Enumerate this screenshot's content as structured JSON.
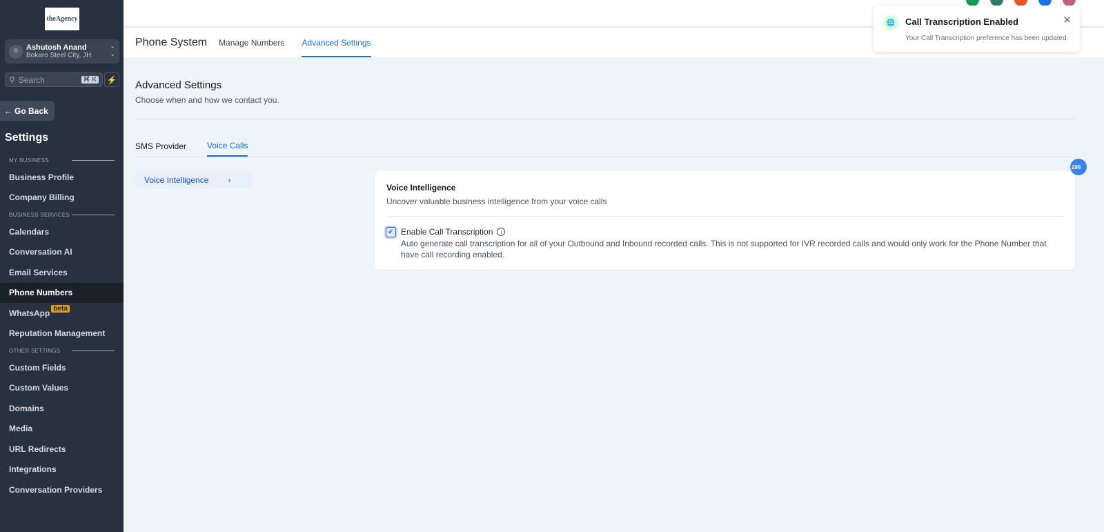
{
  "sidebar": {
    "logo": "theAgency",
    "account": {
      "name": "Ashutosh Anand",
      "location": "Bokaro Steel City, JH"
    },
    "search": {
      "placeholder": "Search",
      "shortcut": "⌘ K"
    },
    "go_back": "Go Back",
    "title": "Settings",
    "sections": [
      {
        "label": "MY BUSINESS",
        "items": [
          "Business Profile",
          "Company Billing"
        ]
      },
      {
        "label": "BUSINESS SERVICES",
        "items": [
          "Calendars",
          "Conversation AI",
          "Email Services",
          "Phone Numbers",
          "WhatsApp",
          "Reputation Management"
        ]
      },
      {
        "label": "OTHER SETTINGS",
        "items": [
          "Custom Fields",
          "Custom Values",
          "Domains",
          "Media",
          "URL Redirects",
          "Integrations",
          "Conversation Providers"
        ]
      }
    ],
    "active_item": "Phone Numbers",
    "whatsapp_badge": "beta"
  },
  "header": {
    "avatar_colors": [
      "#0f9d58",
      "#2e7d6b",
      "#f4511e",
      "#1a73e8",
      "#c2607f"
    ]
  },
  "subnav": {
    "title": "Phone System",
    "tabs": [
      "Manage Numbers",
      "Advanced Settings"
    ],
    "active": "Advanced Settings"
  },
  "page": {
    "title": "Advanced Settings",
    "subtitle": "Choose when and how we contact you.",
    "tabs": [
      "SMS Provider",
      "Voice Calls"
    ],
    "active_tab": "Voice Calls"
  },
  "left_nav": {
    "item": "Voice Intelligence"
  },
  "card": {
    "title": "Voice Intelligence",
    "description": "Uncover valuable business intelligence from your voice calls",
    "checkbox_label": "Enable Call Transcription",
    "checked": true,
    "checkbox_desc": "Auto generate call transcription for all of your Outbound and Inbound recorded calls. This is not supported for IVR recorded calls and would only work for the Phone Number that have call recording enabled."
  },
  "float_badge": "299",
  "toast": {
    "title": "Call Transcription Enabled",
    "message": "Your Call Transcription preference has been updated"
  }
}
